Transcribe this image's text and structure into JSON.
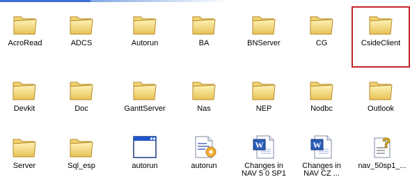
{
  "accent": "#c4242b",
  "rows": [
    [
      {
        "label": "AcroRead",
        "icon": "folder-icon"
      },
      {
        "label": "ADCS",
        "icon": "folder-icon"
      },
      {
        "label": "Autorun",
        "icon": "folder-icon"
      },
      {
        "label": "BA",
        "icon": "folder-icon"
      },
      {
        "label": "BNServer",
        "icon": "folder-icon"
      },
      {
        "label": "CG",
        "icon": "folder-icon"
      },
      {
        "label": "CsideClient",
        "icon": "folder-icon"
      }
    ],
    [
      {
        "label": "Devkit",
        "icon": "folder-icon"
      },
      {
        "label": "Doc",
        "icon": "folder-icon"
      },
      {
        "label": "GanttServer",
        "icon": "folder-icon"
      },
      {
        "label": "Nas",
        "icon": "folder-icon"
      },
      {
        "label": "NEP",
        "icon": "folder-icon"
      },
      {
        "label": "Nodbc",
        "icon": "folder-icon"
      },
      {
        "label": "Outlook",
        "icon": "folder-icon"
      }
    ],
    [
      {
        "label": "Server",
        "icon": "folder-icon"
      },
      {
        "label": "Sql_esp",
        "icon": "folder-icon"
      },
      {
        "label": "autorun",
        "icon": "application-icon"
      },
      {
        "label": "autorun",
        "icon": "setup-info-icon"
      },
      {
        "label": "Changes in",
        "label2": "NAV 5 0 SP1",
        "icon": "word-document-icon"
      },
      {
        "label": "Changes in",
        "label2": "NAV CZ ...",
        "icon": "word-document-icon"
      },
      {
        "label": "nav_50sp1_...",
        "icon": "help-file-icon"
      }
    ]
  ]
}
